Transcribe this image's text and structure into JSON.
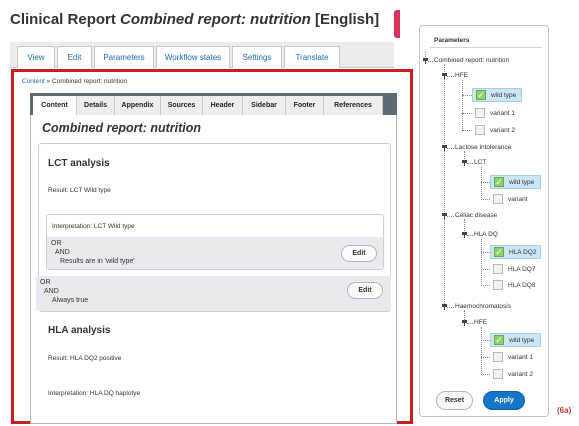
{
  "header": {
    "title_prefix": "Clinical Report ",
    "title_italic": "Combined report: nutrition",
    "title_suffix": " [English]"
  },
  "top_tabs": [
    "View",
    "Edit",
    "Parameters",
    "Workflow states",
    "Settings",
    "Translate"
  ],
  "breadcrumb": {
    "link": "Content",
    "separator": " » ",
    "current": "Combined report: nutrition"
  },
  "inner_tabs": [
    "Content",
    "Details",
    "Appendix",
    "Sources",
    "Header",
    "Sidebar",
    "Footer",
    "References"
  ],
  "report": {
    "title": "Combined report: nutrition",
    "lct": {
      "title": "LCT analysis",
      "result": "Result: LCT Wild type",
      "interpretation": "Interpretation: LCT Wild type",
      "cond1": {
        "op1": "OR",
        "op2": "AND",
        "text": "Results are in 'wild type'",
        "edit": "Edit"
      },
      "cond2": {
        "op1": "OR",
        "op2": "AND",
        "text": "Always true",
        "edit": "Edit"
      }
    },
    "hla": {
      "title": "HLA analysis",
      "result": "Result: HLA DQ2 positive",
      "interpretation": "Interpretation: HLA DQ haplotye"
    }
  },
  "parameters": {
    "heading": "Parameters",
    "root": "Combined report: nutrition",
    "groups": [
      {
        "label": "HFE",
        "options": [
          {
            "label": "wild type",
            "checked": true
          },
          {
            "label": "variant 1",
            "checked": false
          },
          {
            "label": "variant 2",
            "checked": false
          }
        ]
      },
      {
        "label": "Lactose intolerance",
        "sub": "LCT",
        "options": [
          {
            "label": "wild type",
            "checked": true
          },
          {
            "label": "variant",
            "checked": false
          }
        ]
      },
      {
        "label": "Celiac disease",
        "sub": "HLA DQ",
        "options": [
          {
            "label": "HLA DQ2",
            "checked": true
          },
          {
            "label": "HLA DQ7",
            "checked": false
          },
          {
            "label": "HLA DQ8",
            "checked": false
          }
        ]
      },
      {
        "label": "Haemochromatosis",
        "sub": "HFE",
        "options": [
          {
            "label": "wild type",
            "checked": true
          },
          {
            "label": "variant 1",
            "checked": false
          },
          {
            "label": "variant 2",
            "checked": false
          }
        ]
      }
    ],
    "reset": "Reset",
    "apply": "Apply"
  },
  "figure_label": "(6a)",
  "colors": {
    "frame": "#c81e1e",
    "accent": "#1674c9",
    "link": "#1b6ab3",
    "selected": "#cde6f6"
  }
}
